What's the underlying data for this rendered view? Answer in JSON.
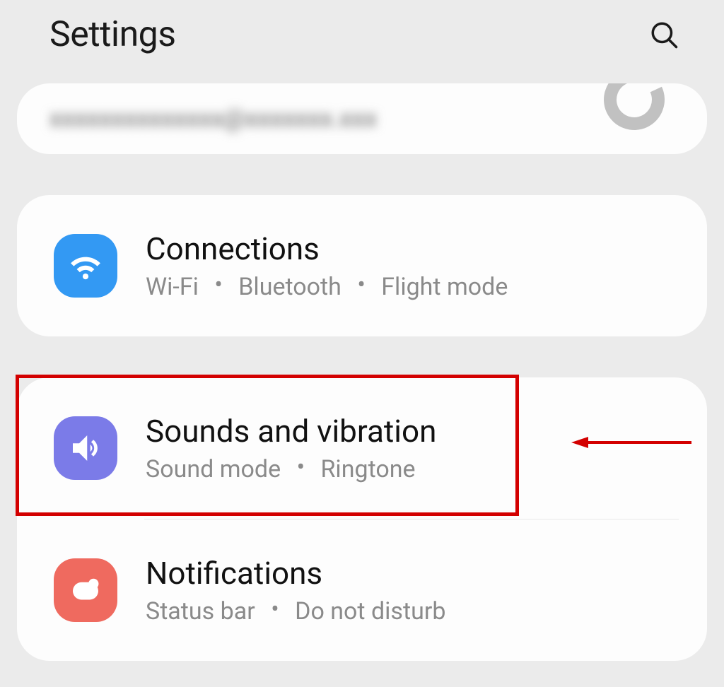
{
  "header": {
    "title": "Settings"
  },
  "account": {
    "blurred_email": "xxxxxxxxxxxxxx@xxxxxxx.xxx"
  },
  "items": {
    "connections": {
      "title": "Connections",
      "sub1": "Wi-Fi",
      "sub2": "Bluetooth",
      "sub3": "Flight mode"
    },
    "sounds": {
      "title": "Sounds and vibration",
      "sub1": "Sound mode",
      "sub2": "Ringtone"
    },
    "notifications": {
      "title": "Notifications",
      "sub1": "Status bar",
      "sub2": "Do not disturb"
    }
  },
  "separator": "•"
}
